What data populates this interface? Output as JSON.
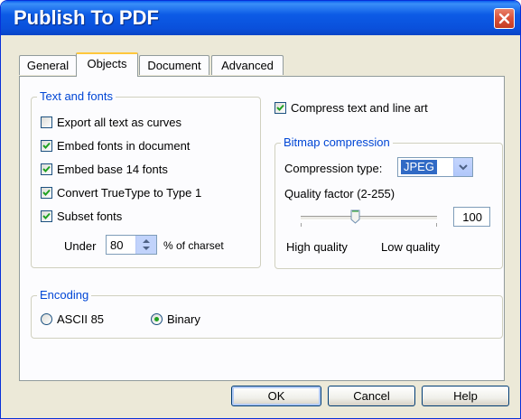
{
  "window": {
    "title": "Publish To PDF"
  },
  "tabs": [
    {
      "label": "General"
    },
    {
      "label": "Objects"
    },
    {
      "label": "Document"
    },
    {
      "label": "Advanced"
    }
  ],
  "active_tab": "Objects",
  "text_fonts": {
    "group_label": "Text and fonts",
    "options": [
      {
        "label": "Export all text as curves",
        "checked": false
      },
      {
        "label": "Embed fonts in document",
        "checked": true
      },
      {
        "label": "Embed base 14 fonts",
        "checked": true
      },
      {
        "label": "Convert TrueType to Type 1",
        "checked": true
      },
      {
        "label": "Subset fonts",
        "checked": true
      }
    ],
    "under_label": "Under",
    "under_value": "80",
    "charset_label": "% of charset"
  },
  "compress": {
    "label": "Compress text and line art",
    "checked": true
  },
  "bitmap": {
    "group_label": "Bitmap compression",
    "type_label": "Compression type:",
    "type_value": "JPEG",
    "quality_label": "Quality factor (2-255)",
    "quality_value": "100",
    "quality_level": 0.4,
    "high_label": "High quality",
    "low_label": "Low quality"
  },
  "encoding": {
    "group_label": "Encoding",
    "options": [
      {
        "label": "ASCII 85",
        "selected": false
      },
      {
        "label": "Binary",
        "selected": true
      }
    ]
  },
  "buttons": {
    "ok": "OK",
    "cancel": "Cancel",
    "help": "Help"
  },
  "colors": {
    "title_bar": "#0a50db",
    "group_label": "#0046d5",
    "check": "#21a121",
    "close": "#d9513a"
  }
}
